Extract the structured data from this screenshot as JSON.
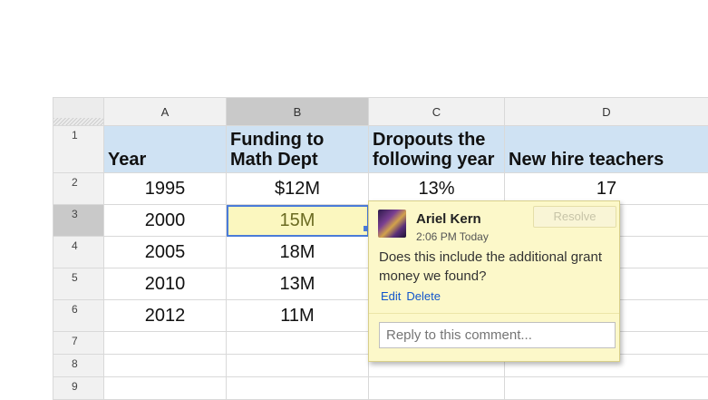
{
  "columns": [
    "A",
    "B",
    "C",
    "D"
  ],
  "header_row": {
    "row_number": "1",
    "cells": [
      "Year",
      "Funding to Math Dept",
      "Dropouts the following year",
      "New hire teachers"
    ]
  },
  "rows": [
    {
      "row_number": "2",
      "cells": [
        "1995",
        "$12M",
        "13%",
        "17"
      ]
    },
    {
      "row_number": "3",
      "cells": [
        "2000",
        "15M",
        "",
        ""
      ]
    },
    {
      "row_number": "4",
      "cells": [
        "2005",
        "18M",
        "",
        ""
      ]
    },
    {
      "row_number": "5",
      "cells": [
        "2010",
        "13M",
        "",
        ""
      ]
    },
    {
      "row_number": "6",
      "cells": [
        "2012",
        "11M",
        "",
        ""
      ]
    }
  ],
  "empty_rows": [
    "7",
    "8",
    "9"
  ],
  "selection": {
    "column": "B",
    "row": "3"
  },
  "comment": {
    "author": "Ariel Kern",
    "time": "2:06 PM Today",
    "text": "Does this include the additional grant money we found?",
    "resolve_label": "Resolve",
    "edit_label": "Edit",
    "delete_label": "Delete",
    "reply_placeholder": "Reply to this comment..."
  },
  "colors": {
    "header_fill": "#cfe2f3",
    "active_cell": "#fbf7bf",
    "comment_bg": "#fcf8c9",
    "link": "#1155cc",
    "selection_border": "#4a7bd8"
  }
}
